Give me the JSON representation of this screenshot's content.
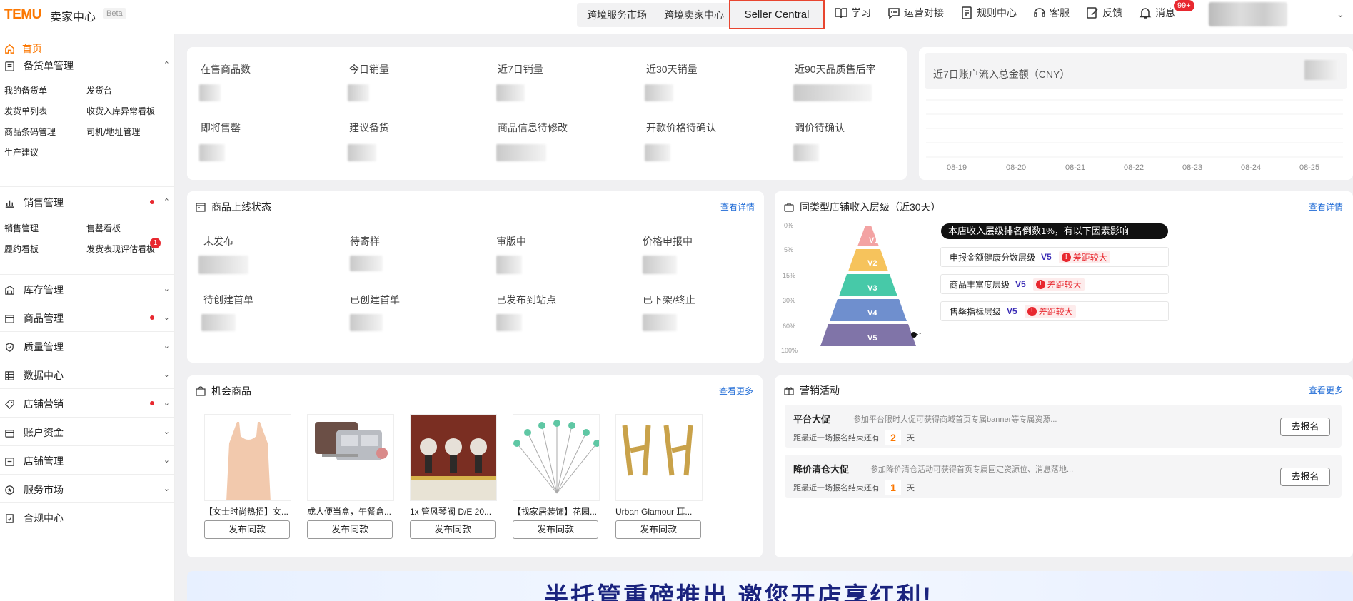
{
  "topbar": {
    "logo": "TEMU",
    "brand": "卖家中心",
    "beta": "Beta",
    "nav": [
      "跨境服务市场",
      "跨境卖家中心"
    ],
    "seller_central": "Seller Central",
    "icons": [
      {
        "icon": "book-icon",
        "label": "学习"
      },
      {
        "icon": "chat-icon",
        "label": "运营对接"
      },
      {
        "icon": "doc-icon",
        "label": "规则中心"
      },
      {
        "icon": "headset-icon",
        "label": "客服"
      },
      {
        "icon": "feedback-icon",
        "label": "反馈"
      },
      {
        "icon": "bell-icon",
        "label": "消息"
      }
    ],
    "msg_badge": "99+"
  },
  "sidebar": {
    "home": "首页",
    "stock": {
      "label": "备货单管理",
      "items": [
        "我的备货单",
        "发货台",
        "发货单列表",
        "收货入库异常看板",
        "商品条码管理",
        "司机/地址管理",
        "生产建议"
      ]
    },
    "sales": {
      "label": "销售管理",
      "items": [
        "销售管理",
        "售罄看板",
        "履约看板",
        "发货表现评估看板"
      ],
      "badge": "1"
    },
    "sections": [
      "库存管理",
      "商品管理",
      "质量管理",
      "数据中心",
      "店铺营销",
      "账户资金",
      "店铺管理",
      "服务市场",
      "合规中心"
    ]
  },
  "stats": {
    "row1": [
      "在售商品数",
      "今日销量",
      "近7日销量",
      "近30天销量",
      "近90天品质售后率"
    ],
    "row2": [
      "即将售罄",
      "建议备货",
      "商品信息待修改",
      "开款价格待确认",
      "调价待确认"
    ]
  },
  "account": {
    "title": "近7日账户流入总金额（CNY）",
    "dates": [
      "08-19",
      "08-20",
      "08-21",
      "08-22",
      "08-23",
      "08-24",
      "08-25"
    ]
  },
  "listing": {
    "title": "商品上线状态",
    "link": "查看详情",
    "row1": [
      "未发布",
      "待寄样",
      "审版中",
      "价格申报中"
    ],
    "row2": [
      "待创建首单",
      "已创建首单",
      "已发布到站点",
      "已下架/终止"
    ]
  },
  "tier": {
    "title": "同类型店铺收入层级（近30天）",
    "link": "查看详情",
    "axis": [
      "0%",
      "5%",
      "15%",
      "30%",
      "60%",
      "100%"
    ],
    "levels": [
      "V1",
      "V2",
      "V3",
      "V4",
      "V5"
    ],
    "callout": "本店收入层级排名倒数1%，有以下因素影响",
    "factors": [
      {
        "label": "申报金额健康分数层级",
        "level": "V5",
        "gap": "差距较大"
      },
      {
        "label": "商品丰富度层级",
        "level": "V5",
        "gap": "差距较大"
      },
      {
        "label": "售罄指标层级",
        "level": "V5",
        "gap": "差距较大"
      }
    ]
  },
  "opportunity": {
    "title": "机会商品",
    "link": "查看更多",
    "button": "发布同款",
    "products": [
      {
        "name": "【女士时尚热招】女..."
      },
      {
        "name": "成人便当盒，午餐盒..."
      },
      {
        "name": "1x 管风琴阀 D/E 20..."
      },
      {
        "name": "【找家居装饰】花园..."
      },
      {
        "name": "Urban Glamour 耳..."
      }
    ]
  },
  "marketing": {
    "title": "营销活动",
    "link": "查看更多",
    "items": [
      {
        "title": "平台大促",
        "desc": "参加平台限时大促可获得商城首页专属banner等专属资源...",
        "countdown_prefix": "距最近一场报名结束还有",
        "days": "2",
        "unit": "天",
        "button": "去报名"
      },
      {
        "title": "降价清仓大促",
        "desc": "参加降价清仓活动可获得首页专属固定资源位、消息落地...",
        "countdown_prefix": "距最近一场报名结束还有",
        "days": "1",
        "unit": "天",
        "button": "去报名"
      }
    ]
  },
  "banner": {
    "text": "半托管重磅推出 邀您开店享红利!"
  },
  "colors": {
    "accent": "#fb7701",
    "link": "#1f6bd6",
    "alert": "#e8282f"
  }
}
